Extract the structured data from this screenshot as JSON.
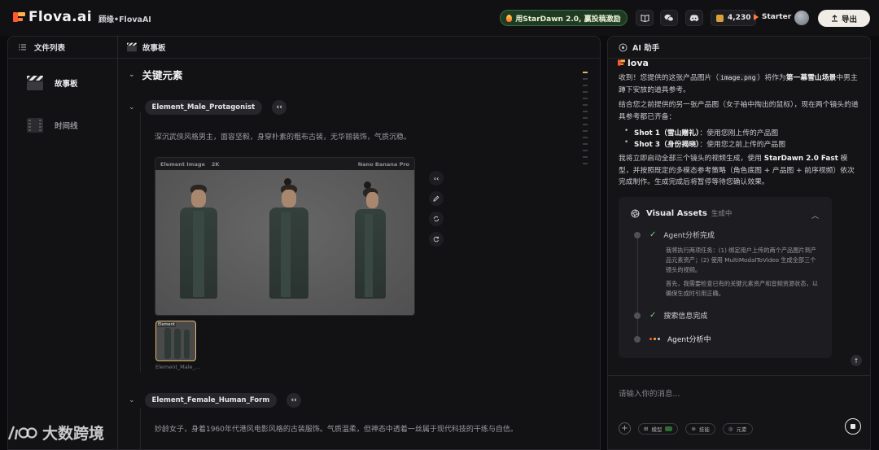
{
  "app": {
    "logo_text": "Flova.ai",
    "breadcrumb": "顾缘•FlovaAI"
  },
  "topbar": {
    "promo_label": "用StarDawn 2.0, 赢投稿激励",
    "credits": "4,230",
    "plan": "Starter",
    "export_label": "导出",
    "icons": [
      "book-icon",
      "wechat-icon",
      "discord-icon"
    ]
  },
  "sidebar": {
    "header": "文件列表",
    "items": [
      {
        "label": "故事板",
        "icon": "clapperboard-icon"
      },
      {
        "label": "时间线",
        "icon": "film-strip-icon"
      }
    ]
  },
  "storyboard": {
    "header": "故事板",
    "section_title": "关键元素",
    "elements": [
      {
        "name": "Element_Male_Protagonist",
        "quote": "‹‹",
        "description": "深沉武侠风格男主，面容坚毅，身穿朴素的粗布古装，无华丽装饰，气质沉稳。",
        "image_label": "Element Image",
        "image_quality": "2K",
        "image_model": "Nano Banana Pro",
        "thumb_label": "Element",
        "thumb_caption": "Element_Male_..."
      },
      {
        "name": "Element_Female_Human_Form",
        "quote": "‹‹",
        "description": "妙龄女子，身着1960年代港风电影风格的古装服饰。气质温柔，但神态中透着一丝属于现代科技的干练与自信。"
      }
    ]
  },
  "ai_panel": {
    "header": "AI 助手",
    "brand": "lova",
    "para1_a": "收到！您提供的这张产品图片（",
    "para1_code": "image.png",
    "para1_b": "）将作为",
    "para1_bold": "第一幕雪山场景",
    "para1_c": "中男主蹲下安放的道具参考。",
    "para2": "结合您之前提供的另一张产品图（女子袖中掏出的鼠标），现在两个镜头的道具参考都已齐备：",
    "bullets": [
      {
        "bold": "Shot 1（雪山赠礼）",
        "text": "：使用您刚上传的产品图"
      },
      {
        "bold": "Shot 3（身份揭晓）",
        "text": "：使用您之前上传的产品图"
      }
    ],
    "para3_a": "我将立即启动全部三个镜头的视频生成，使用 ",
    "para3_bold": "StarDawn 2.0 Fast",
    "para3_b": " 模型，并按照既定的多模态参考策略（角色底图 + 产品图 + 前序视频）依次完成制作。生成完成后将暂停等待您确认效果。",
    "visual_assets": {
      "title": "Visual Assets",
      "status": "生成中",
      "steps": [
        {
          "label": "Agent分析完成",
          "state": "done"
        },
        {
          "label": "搜索信息完成",
          "state": "done"
        },
        {
          "label": "Agent分析中",
          "state": "running"
        }
      ],
      "detail1": "我将执行两项任务：(1) 绑定用户上传的两个产品图片到产品元素资产；(2) 使用 MultiModalToVideo 生成全部三个镜头的视频。",
      "detail2": "首先，我需要检查已有的关键元素资产和音频资源状态，以确保生成时引用正确。"
    },
    "input_placeholder": "请输入你的消息...",
    "chips": [
      "模型",
      "技能",
      "元素"
    ]
  },
  "watermark": {
    "text": "大数跨境"
  },
  "colors": {
    "accent": "#e0b36a",
    "success": "#7ccf7a",
    "brand": "#ff5a2c"
  }
}
